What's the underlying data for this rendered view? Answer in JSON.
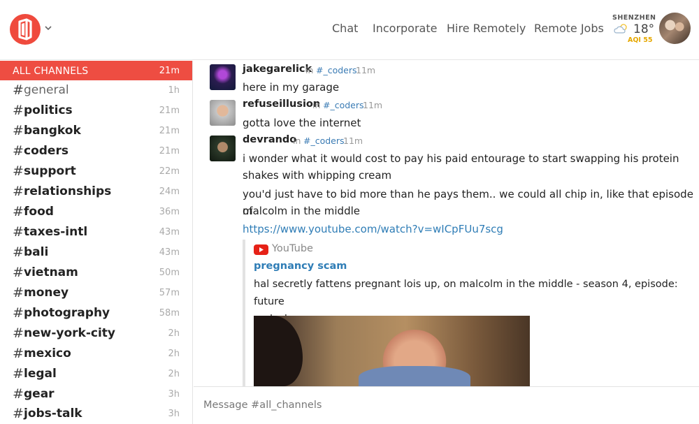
{
  "header": {
    "nav": [
      "Chat",
      "Incorporate",
      "Hire Remotely",
      "Remote Jobs"
    ],
    "weather": {
      "city": "SHENZHEN",
      "temp": "18°",
      "aqi": "AQI 55"
    }
  },
  "sidebar": {
    "all_channels": {
      "label": "ALL CHANNELS",
      "time": "21m"
    },
    "channels": [
      {
        "name": "general",
        "time": "1h"
      },
      {
        "name": "politics",
        "time": "21m"
      },
      {
        "name": "bangkok",
        "time": "21m"
      },
      {
        "name": "coders",
        "time": "21m"
      },
      {
        "name": "support",
        "time": "22m"
      },
      {
        "name": "relationships",
        "time": "24m"
      },
      {
        "name": "food",
        "time": "36m"
      },
      {
        "name": "taxes-intl",
        "time": "43m"
      },
      {
        "name": "bali",
        "time": "43m"
      },
      {
        "name": "vietnam",
        "time": "50m"
      },
      {
        "name": "money",
        "time": "57m"
      },
      {
        "name": "photography",
        "time": "58m"
      },
      {
        "name": "new-york-city",
        "time": "2h"
      },
      {
        "name": "mexico",
        "time": "2h"
      },
      {
        "name": "legal",
        "time": "2h"
      },
      {
        "name": "gear",
        "time": "3h"
      },
      {
        "name": "jobs-talk",
        "time": "3h"
      }
    ],
    "hash": "#"
  },
  "messages": [
    {
      "user": "jakegarelick",
      "in": "in",
      "channel": "#_coders",
      "time": "11m",
      "lines": [
        "here in my garage"
      ]
    },
    {
      "user": "refuseillusion",
      "in": "in",
      "channel": "#_coders",
      "time": "11m",
      "lines": [
        "gotta love the internet"
      ]
    },
    {
      "user": "devrando",
      "in": "in",
      "channel": "#_coders",
      "time": "11m",
      "lines": [
        "i wonder what it would cost to pay his paid entourage to start swapping his protein",
        "shakes with whipping cream",
        "you'd just have to bid more than he pays them.. we could all chip in, like that episode of",
        "malcolm in the middle"
      ],
      "link": "https://www.youtube.com/watch?v=wICpFUu7scg",
      "embed": {
        "provider": "YouTube",
        "title": "pregnancy scam",
        "desc_line1": "hal secretly fattens pregnant lois up, on malcolm in the middle - season 4, episode: future",
        "desc_line2": "malcolm"
      }
    }
  ],
  "composer": {
    "placeholder": "Message #all_channels"
  },
  "colors": {
    "accent": "#ee4d42",
    "link": "#2f7db6",
    "aqi": "#e6a800"
  }
}
